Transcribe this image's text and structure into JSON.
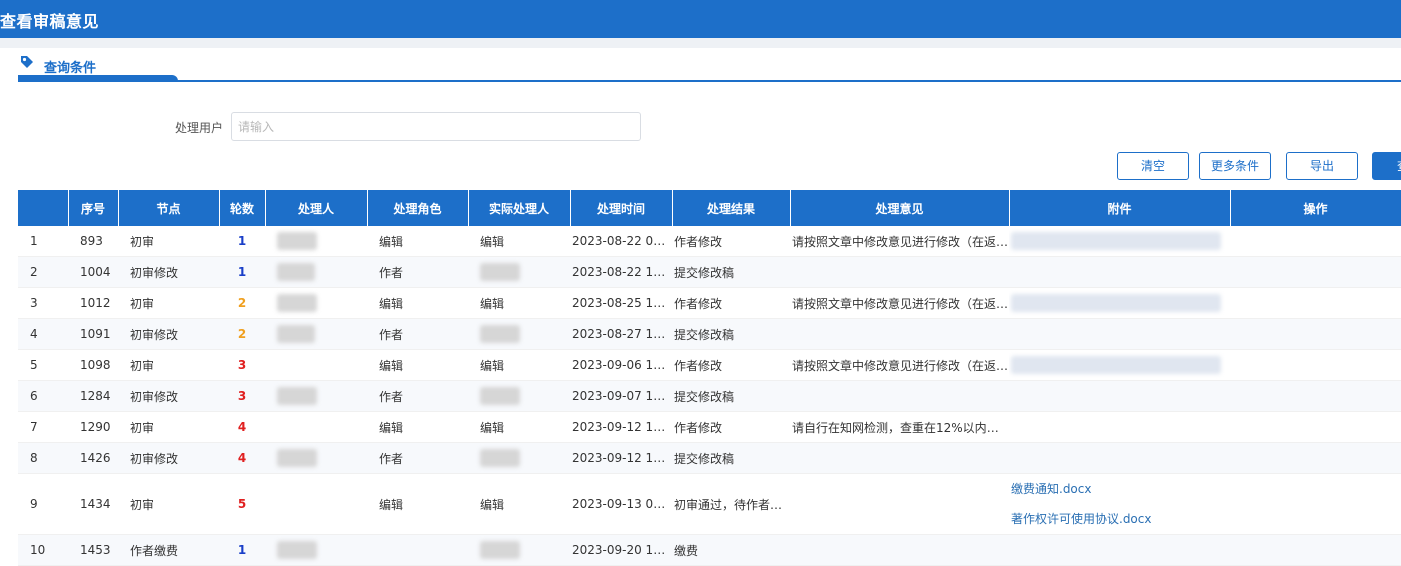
{
  "page": {
    "title": "查看审稿意见"
  },
  "section": {
    "label": "查询条件"
  },
  "filter": {
    "label": "处理用户",
    "placeholder": "请输入",
    "value": ""
  },
  "buttons": {
    "clear": "清空",
    "more": "更多条件",
    "export": "导出",
    "search": "查"
  },
  "table": {
    "headers": [
      "",
      "序号",
      "节点",
      "轮数",
      "处理人",
      "处理角色",
      "实际处理人",
      "处理时间",
      "处理结果",
      "处理意见",
      "附件",
      "操作"
    ],
    "rows": [
      {
        "idx": "1",
        "seq": "893",
        "node": "初审",
        "round": "1",
        "round_color": "#1a3fc8",
        "handler": "",
        "role": "编辑",
        "actual": "编辑",
        "time": "2023-08-22 09:…",
        "result": "作者修改",
        "opinion": "请按照文章中修改意见进行修改（在返…",
        "attachments": []
      },
      {
        "idx": "2",
        "seq": "1004",
        "node": "初审修改",
        "round": "1",
        "round_color": "#1a3fc8",
        "handler": "",
        "role": "作者",
        "actual": "",
        "time": "2023-08-22 11:…",
        "result": "提交修改稿",
        "opinion": "",
        "attachments": []
      },
      {
        "idx": "3",
        "seq": "1012",
        "node": "初审",
        "round": "2",
        "round_color": "#f0a020",
        "handler": "",
        "role": "编辑",
        "actual": "编辑",
        "time": "2023-08-25 17:…",
        "result": "作者修改",
        "opinion": "请按照文章中修改意见进行修改（在返…",
        "attachments": []
      },
      {
        "idx": "4",
        "seq": "1091",
        "node": "初审修改",
        "round": "2",
        "round_color": "#f0a020",
        "handler": "",
        "role": "作者",
        "actual": "",
        "time": "2023-08-27 13:…",
        "result": "提交修改稿",
        "opinion": "",
        "attachments": []
      },
      {
        "idx": "5",
        "seq": "1098",
        "node": "初审",
        "round": "3",
        "round_color": "#e02020",
        "handler": "",
        "role": "编辑",
        "actual": "编辑",
        "time": "2023-09-06 17:…",
        "result": "作者修改",
        "opinion": "请按照文章中修改意见进行修改（在返…",
        "attachments": []
      },
      {
        "idx": "6",
        "seq": "1284",
        "node": "初审修改",
        "round": "3",
        "round_color": "#e02020",
        "handler": "",
        "role": "作者",
        "actual": "",
        "time": "2023-09-07 10:…",
        "result": "提交修改稿",
        "opinion": "",
        "attachments": []
      },
      {
        "idx": "7",
        "seq": "1290",
        "node": "初审",
        "round": "4",
        "round_color": "#e02020",
        "handler": "",
        "role": "编辑",
        "actual": "编辑",
        "time": "2023-09-12 11:…",
        "result": "作者修改",
        "opinion": "请自行在知网检测，查重在12%以内，…",
        "attachments": []
      },
      {
        "idx": "8",
        "seq": "1426",
        "node": "初审修改",
        "round": "4",
        "round_color": "#e02020",
        "handler": "",
        "role": "作者",
        "actual": "",
        "time": "2023-09-12 14:…",
        "result": "提交修改稿",
        "opinion": "",
        "attachments": []
      },
      {
        "idx": "9",
        "seq": "1434",
        "node": "初审",
        "round": "5",
        "round_color": "#e02020",
        "handler": "",
        "role": "编辑",
        "actual": "编辑",
        "time": "2023-09-13 09:…",
        "result": "初审通过，待作者…",
        "opinion": "",
        "attachments": [
          "缴费通知.docx",
          "著作权许可使用协议.docx"
        ]
      },
      {
        "idx": "10",
        "seq": "1453",
        "node": "作者缴费",
        "round": "1",
        "round_color": "#1a3fc8",
        "handler": "",
        "role": "",
        "actual": "",
        "time": "2023-09-20 11:…",
        "result": "缴费",
        "opinion": "",
        "attachments": []
      }
    ]
  }
}
